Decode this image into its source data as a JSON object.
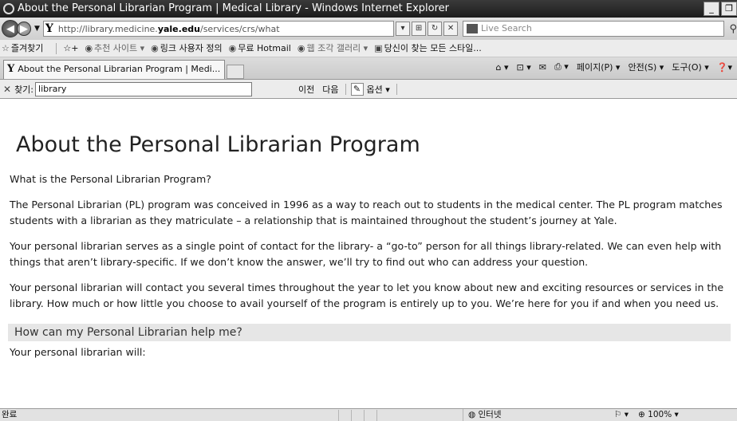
{
  "window": {
    "title": "About the Personal Librarian Program | Medical Library - Windows Internet Explorer",
    "minimize_glyph": "_",
    "restore_glyph": "❐"
  },
  "address_bar": {
    "back_glyph": "◀",
    "forward_glyph": "▶",
    "favicon": "Y",
    "url_prefix": "http://library.medicine.",
    "url_domain": "yale.edu",
    "url_path": "/services/crs/what",
    "search_placeholder": "Live Search",
    "search_icon": "search-icon"
  },
  "favorites_bar": {
    "favorites_label": "즐겨찾기",
    "suggested_sites": "추천 사이트 ▾",
    "link_definition": "링크 사용자 정의",
    "hotmail": "무료 Hotmail",
    "web_slice_gallery": "웹 조각 갤러리 ▾",
    "all_styles": "당신이 찾는 모든 스타일..."
  },
  "tab": {
    "favicon": "Y",
    "label": "About the Personal Librarian Program | Medi..."
  },
  "command_bar": {
    "home_glyph": "⌂ ▾",
    "feeds_glyph": "⊡ ▾",
    "mail_glyph": "✉",
    "print_glyph": "⎙ ▾",
    "page_menu": "페이지(P) ▾",
    "safety_menu": "안전(S) ▾",
    "tools_menu": "도구(O) ▾",
    "help_glyph": "❓▾"
  },
  "find_bar": {
    "close_glyph": "✕",
    "label": "찾기:",
    "query": "library",
    "prev_label": "이전",
    "next_label": "다음",
    "options_label": "옵션 ▾"
  },
  "page": {
    "title": "About the Personal Librarian Program",
    "question": "What is the Personal Librarian Program?",
    "para1": "The Personal Librarian (PL) program was conceived in 1996 as a way to reach out to students in the medical center. The PL program matches students with a librarian as they matriculate – a relationship that is maintained throughout the student’s journey at Yale.",
    "para2": "Your personal librarian serves as a single point of contact for the library- a “go-to” person for all things library-related. We can even help with things that aren’t library-specific. If we don’t know the answer, we’ll try to find out who can address your question.",
    "para3": "Your personal librarian will contact you several times throughout the year to let you know about new and exciting resources or services in the library. How much or how little you choose to avail yourself of the program is entirely up to you. We’re here for you if and when you need us.",
    "subheading": "How can my Personal Librarian help me?",
    "will_line": "Your personal librarian will:"
  },
  "status_bar": {
    "status_text": "완료",
    "zone_label": "인터넷",
    "protected_glyph": "⚐ ▾",
    "zoom_label": "100%"
  },
  "colors": {
    "titlebar": "#2a2a2a",
    "subhead_bg": "#e6e6e6"
  }
}
